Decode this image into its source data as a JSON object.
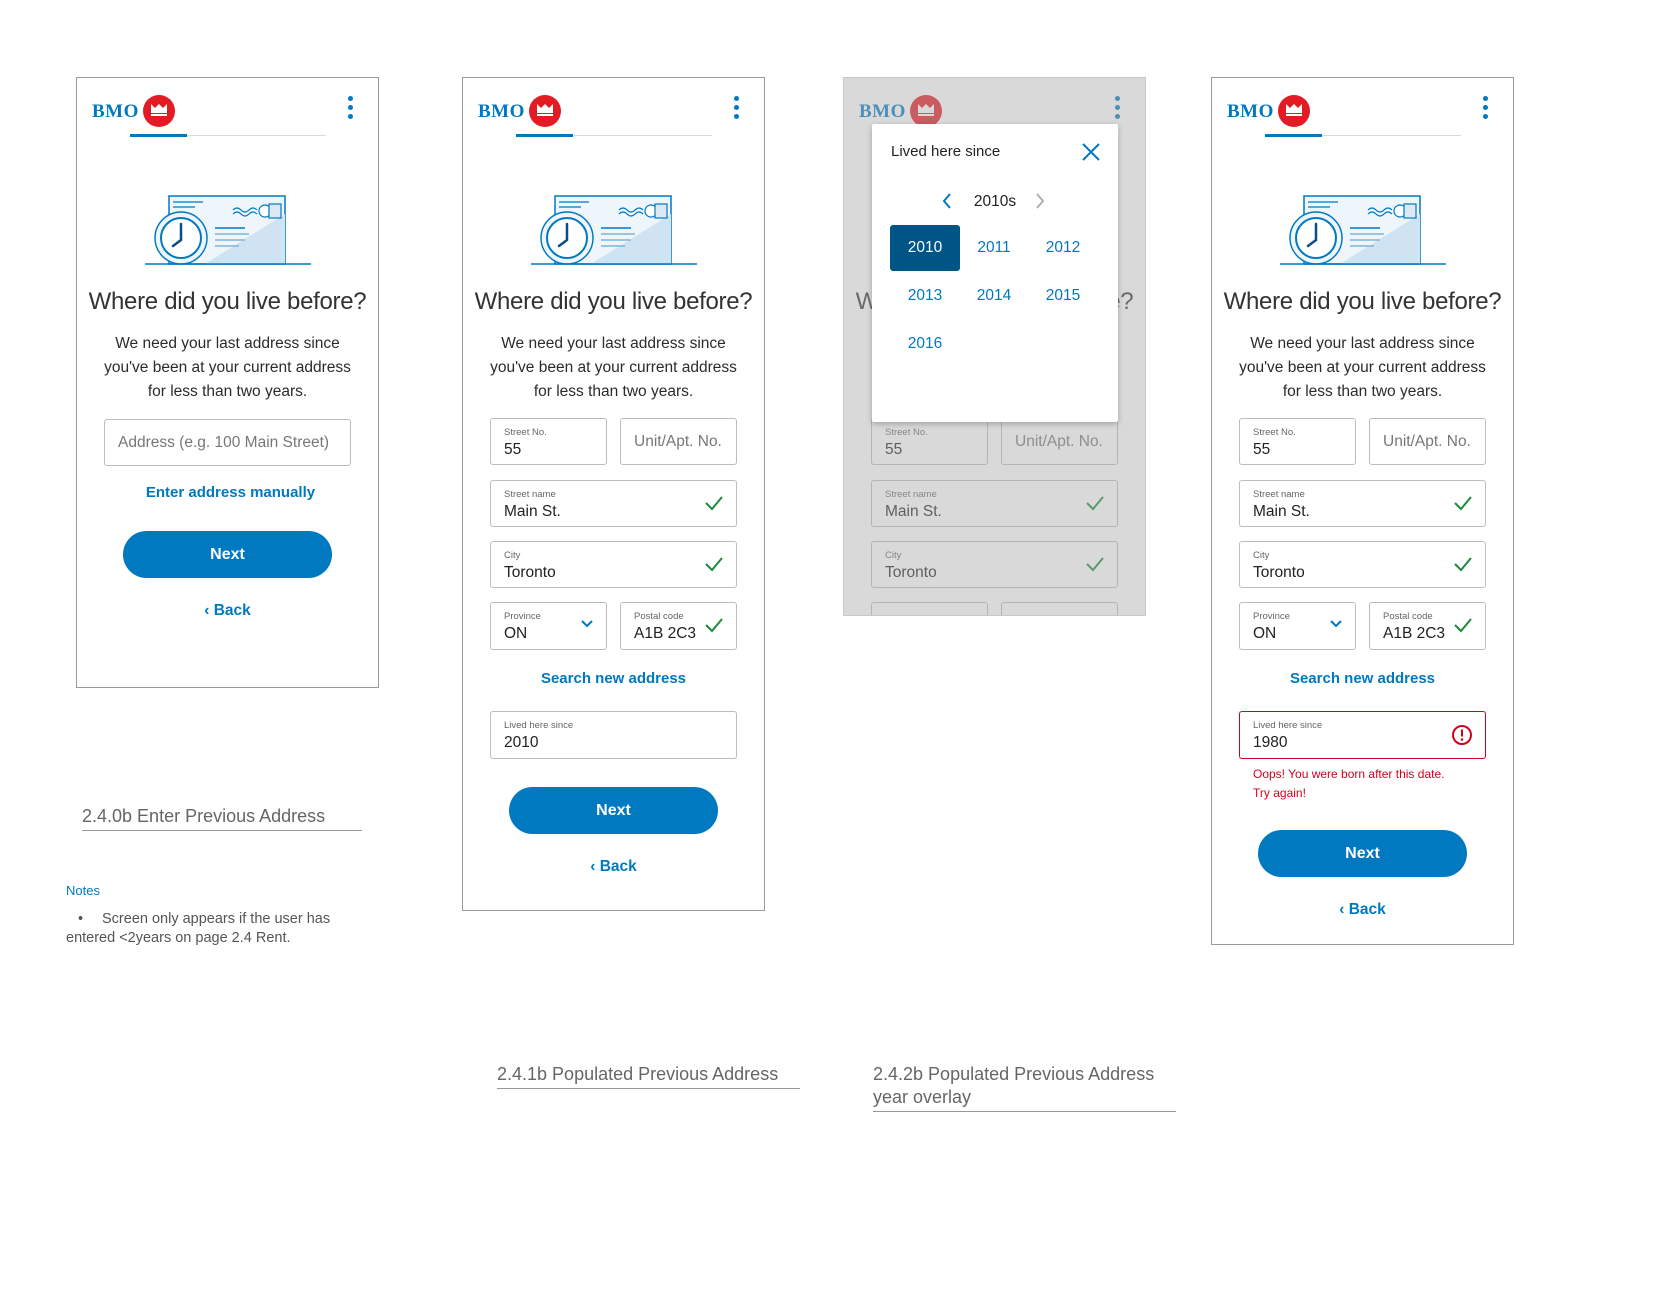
{
  "brand": {
    "name": "BMO"
  },
  "common": {
    "heading": "Where did you live before?",
    "subtext_lines": [
      "We need your last address since",
      "you've been at your current address",
      "for less than two years."
    ],
    "next_label": "Next",
    "back_label": "Back",
    "search_new_address": "Search new address"
  },
  "screen1": {
    "address_placeholder": "Address (e.g. 100 Main Street)",
    "enter_manually": "Enter address manually",
    "caption": "2.4.0b Enter Previous Address"
  },
  "fields": {
    "street_no_label": "Street No.",
    "street_no_value": "55",
    "unit_placeholder": "Unit/Apt. No.",
    "street_name_label": "Street name",
    "street_name_value": "Main St.",
    "city_label": "City",
    "city_value": "Toronto",
    "province_label": "Province",
    "province_value": "ON",
    "postal_label": "Postal code",
    "postal_value": "A1B 2C3",
    "lived_label": "Lived here since"
  },
  "screen2": {
    "lived_value": "2010",
    "caption": "2.4.1b Populated Previous Address"
  },
  "screen3": {
    "modal_title": "Lived here since",
    "decade": "2010s",
    "years": [
      "2010",
      "2011",
      "2012",
      "2013",
      "2014",
      "2015",
      "2016"
    ],
    "selected_year": "2010",
    "caption_line1": "2.4.2b Populated Previous Address",
    "caption_line2": "year overlay"
  },
  "screen4": {
    "lived_value": "1980",
    "error_line1": "Oops! You were born after this date.",
    "error_line2": "Try again!",
    "error_color": "#d0021b"
  },
  "notes": {
    "title": "Notes",
    "bullet": "•",
    "line1": "Screen only appears if the user has",
    "line2": "entered <2years on page 2.4 Rent."
  },
  "colors": {
    "brand_blue": "#0079c1",
    "brand_red": "#e31b23",
    "selected_year": "#005587",
    "check_green": "#1e8a3c"
  }
}
